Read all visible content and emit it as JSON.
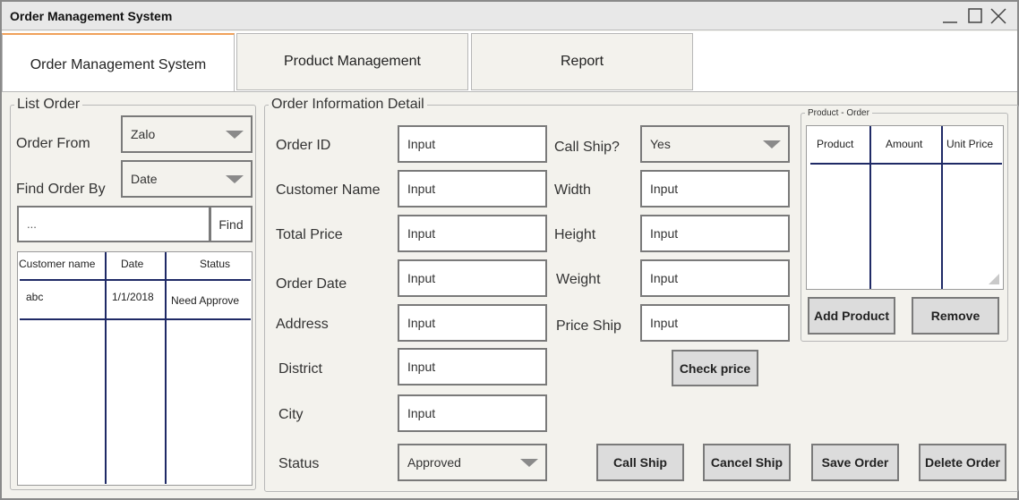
{
  "window": {
    "title": "Order Management System"
  },
  "tabs": [
    {
      "label": "Order Management System"
    },
    {
      "label": "Product Management"
    },
    {
      "label": "Report"
    }
  ],
  "list_order": {
    "legend": "List Order",
    "order_from_label": "Order From",
    "order_from_value": "Zalo",
    "find_by_label": "Find Order By",
    "find_by_value": "Date",
    "search_value": "...",
    "find_button": "Find",
    "table": {
      "headers": [
        "Customer name",
        "Date",
        "Status"
      ],
      "rows": [
        [
          "abc",
          "1/1/2018",
          "Need Approve"
        ]
      ]
    }
  },
  "detail": {
    "legend": "Order Information Detail",
    "fields": {
      "order_id": {
        "label": "Order ID",
        "value": "Input"
      },
      "customer_name": {
        "label": "Customer Name",
        "value": "Input"
      },
      "total_price": {
        "label": "Total Price",
        "value": "Input"
      },
      "order_date": {
        "label": "Order Date",
        "value": "Input"
      },
      "address": {
        "label": "Address",
        "value": "Input"
      },
      "district": {
        "label": "District",
        "value": "Input"
      },
      "city": {
        "label": "City",
        "value": "Input"
      },
      "status": {
        "label": "Status",
        "value": "Approved"
      },
      "call_ship": {
        "label": "Call Ship?",
        "value": "Yes"
      },
      "width": {
        "label": "Width",
        "value": "Input"
      },
      "height": {
        "label": "Height",
        "value": "Input"
      },
      "weight": {
        "label": "Weight",
        "value": "Input"
      },
      "price_ship": {
        "label": "Price Ship",
        "value": "Input"
      }
    },
    "check_price_button": "Check price"
  },
  "product_order": {
    "legend": "Product - Order",
    "headers": [
      "Product",
      "Amount",
      "Unit Price"
    ],
    "add_button": "Add Product",
    "remove_button": "Remove"
  },
  "actions": {
    "call_ship": "Call Ship",
    "cancel_ship": "Cancel Ship",
    "save_order": "Save Order",
    "delete_order": "Delete Order"
  },
  "icons": {
    "minimize": "minimize-icon",
    "maximize": "maximize-icon",
    "close": "close-icon",
    "dropdown": "chevron-down-icon",
    "resize": "resize-grip-icon"
  },
  "colors": {
    "active_tab_accent": "#f0a15a",
    "table_lines": "#1f2a66",
    "background": "#f3f2ed"
  }
}
